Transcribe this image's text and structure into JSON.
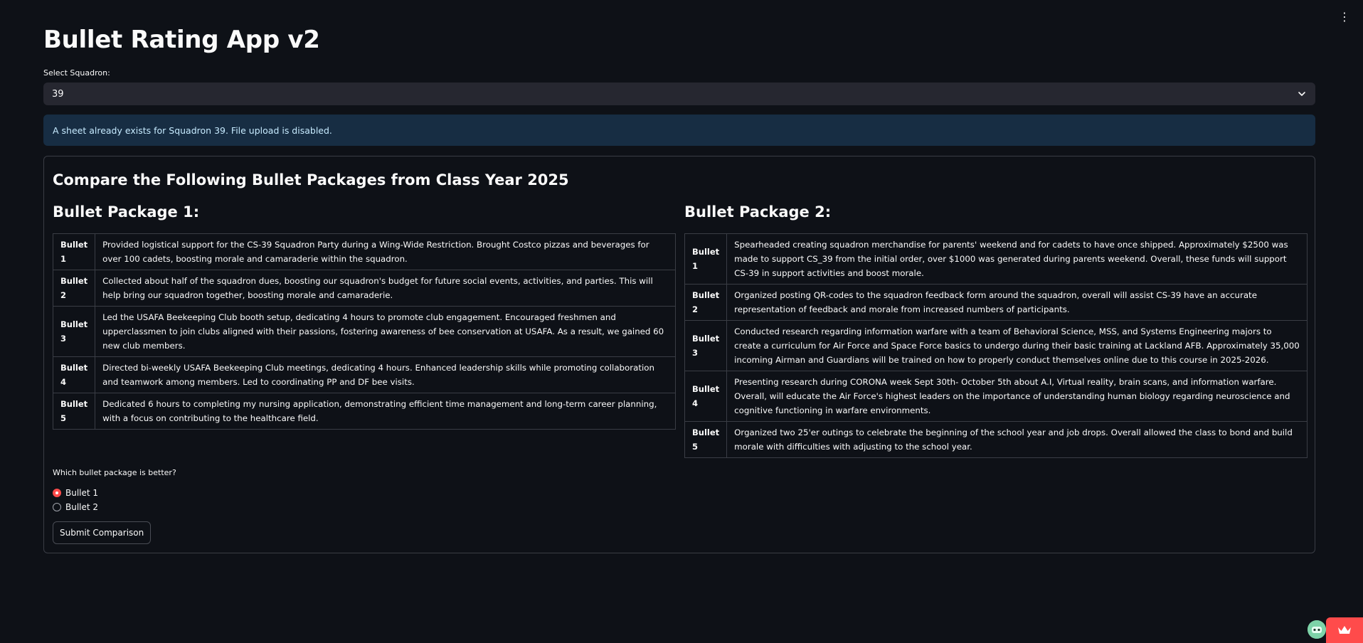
{
  "app_title": "Bullet Rating App v2",
  "menu_icon": "kebab-menu-icon",
  "squadron_select": {
    "label": "Select Squadron:",
    "value": "39"
  },
  "info_message": "A sheet already exists for Squadron 39. File upload is disabled.",
  "comparison": {
    "heading": "Compare the Following Bullet Packages from Class Year 2025",
    "package1": {
      "title": "Bullet Package 1:",
      "rows": [
        {
          "label": "Bullet 1",
          "text": "Provided logistical support for the CS-39 Squadron Party during a Wing-Wide Restriction. Brought Costco pizzas and beverages for over 100 cadets, boosting morale and camaraderie within the squadron."
        },
        {
          "label": "Bullet 2",
          "text": "Collected about half of the squadron dues, boosting our squadron's budget for future social events, activities, and parties. This will help bring our squadron together, boosting morale and camaraderie."
        },
        {
          "label": "Bullet 3",
          "text": "Led the USAFA Beekeeping Club booth setup, dedicating 4 hours to promote club engagement. Encouraged freshmen and upperclassmen to join clubs aligned with their passions, fostering awareness of bee conservation at USAFA. As a result, we gained 60 new club members."
        },
        {
          "label": "Bullet 4",
          "text": "Directed bi-weekly USAFA Beekeeping Club meetings, dedicating 4 hours. Enhanced leadership skills while promoting collaboration and teamwork among members. Led to coordinating PP and DF bee visits."
        },
        {
          "label": "Bullet 5",
          "text": "Dedicated 6 hours to completing my nursing application, demonstrating efficient time management and long-term career planning, with a focus on contributing to the healthcare field."
        }
      ]
    },
    "package2": {
      "title": "Bullet Package 2:",
      "rows": [
        {
          "label": "Bullet 1",
          "text": "Spearheaded creating squadron merchandise for parents' weekend and for cadets to have once shipped. Approximately $2500 was made to support CS_39 from the initial order, over $1000 was generated during parents weekend. Overall, these funds will support CS-39 in support activities and boost morale."
        },
        {
          "label": "Bullet 2",
          "text": "Organized posting QR-codes to the squadron feedback form around the squadron, overall will assist CS-39 have an accurate representation of feedback and morale from increased numbers of participants."
        },
        {
          "label": "Bullet 3",
          "text": "Conducted research regarding information warfare with a team of Behavioral Science, MSS, and Systems Engineering majors to create a curriculum for Air Force and Space Force basics to undergo during their basic training at Lackland AFB. Approximately 35,000 incoming Airman and Guardians will be trained on how to properly conduct themselves online due to this course in 2025-2026."
        },
        {
          "label": "Bullet 4",
          "text": "Presenting research during CORONA week Sept 30th- October 5th about A.I, Virtual reality, brain scans, and information warfare. Overall, will educate the Air Force's highest leaders on the importance of understanding human biology regarding neuroscience and cognitive functioning in warfare environments."
        },
        {
          "label": "Bullet 5",
          "text": "Organized two 25'er outings to celebrate the beginning of the school year and job drops. Overall allowed the class to bond and build morale with difficulties with adjusting to the school year."
        }
      ]
    },
    "question": "Which bullet package is better?",
    "options": [
      "Bullet 1",
      "Bullet 2"
    ],
    "selected_option": "Bullet 1",
    "submit_label": "Submit Comparison"
  },
  "colors": {
    "background": "#0e1117",
    "accent": "#ff4b4b",
    "info_bg": "#172d43",
    "info_text": "#c7ebff"
  }
}
